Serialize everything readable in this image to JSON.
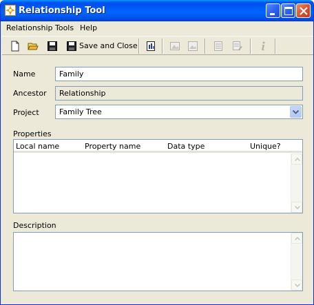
{
  "window": {
    "title": "Relationship Tool",
    "controls": {
      "minimize": "minimize-icon",
      "maximize": "maximize-icon",
      "close": "close-icon"
    }
  },
  "menu": {
    "items": [
      {
        "label": "Relationship"
      },
      {
        "label": "Tools"
      },
      {
        "label": "Help"
      }
    ]
  },
  "toolbar": {
    "save_and_close_label": "Save and Close",
    "icons": [
      "new-icon",
      "open-icon",
      "save-icon",
      "save-close-icon",
      "report-icon",
      "image-icon",
      "picture-icon",
      "list-icon",
      "edit-list-icon",
      "info-icon"
    ]
  },
  "form": {
    "name": {
      "label": "Name",
      "value": "Family"
    },
    "ancestor": {
      "label": "Ancestor",
      "value": "Relationship"
    },
    "project": {
      "label": "Project",
      "value": "Family Tree"
    },
    "properties": {
      "label": "Properties",
      "columns": [
        "Local name",
        "Property name",
        "Data type",
        "Unique?"
      ],
      "rows": []
    },
    "description": {
      "label": "Description",
      "value": ""
    }
  },
  "colors": {
    "titlebar": "#0058ee",
    "window_bg": "#ece9d8",
    "field_border": "#7f9db9",
    "close_button": "#d9532e"
  }
}
